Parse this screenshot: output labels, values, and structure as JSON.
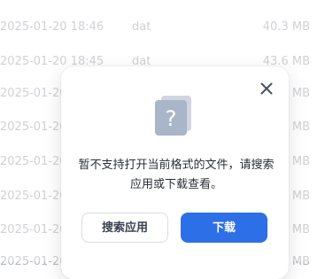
{
  "file_list": {
    "rows": [
      {
        "date": "2025-01-20 18:46",
        "type": "dat",
        "size": "40.3 MB"
      },
      {
        "date": "2025-01-20 18:45",
        "type": "dat",
        "size": "43.6 MB"
      },
      {
        "date": "2025-01-20",
        "type": "",
        "size": "MB"
      },
      {
        "date": "2025-01-20",
        "type": "",
        "size": "MB"
      },
      {
        "date": "2025-01-20",
        "type": "",
        "size": "MB"
      },
      {
        "date": "2025-01-20",
        "type": "",
        "size": "MB"
      },
      {
        "date": "2025-01-20",
        "type": "",
        "size": "MB"
      },
      {
        "date": "2025-01-20",
        "type": "",
        "size": "MB"
      }
    ]
  },
  "dialog": {
    "message": "暂不支持打开当前格式的文件，请搜索应用或下载查看。",
    "buttons": {
      "search_app": "搜索应用",
      "download": "下载"
    },
    "icon": "unknown-file-icon",
    "close_icon": "close-icon"
  },
  "colors": {
    "primary": "#2d6fe6",
    "muted_text": "#b6b9bf",
    "dialog_text": "#2b2f36"
  }
}
